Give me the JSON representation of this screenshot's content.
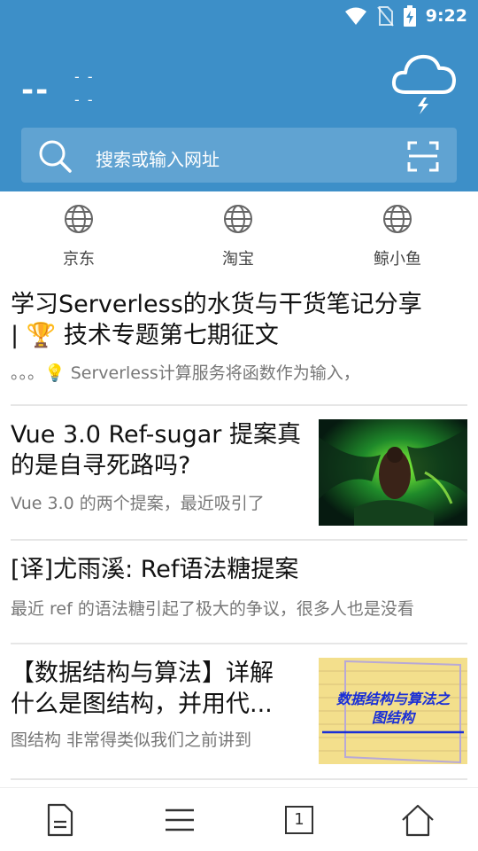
{
  "status_bar": {
    "time": "9:22",
    "icons": [
      "wifi-icon",
      "no-sim-icon",
      "battery-charging-icon"
    ]
  },
  "weather": {
    "temperature": "--",
    "range_high": "- -",
    "range_low": "- -",
    "icon": "cloud-thunder-icon"
  },
  "search": {
    "placeholder": "搜索或输入网址",
    "icon": "search-icon",
    "scan_icon": "scan-icon"
  },
  "shortcuts": [
    {
      "label": "京东",
      "icon": "globe-icon"
    },
    {
      "label": "淘宝",
      "icon": "globe-icon"
    },
    {
      "label": "鲸小鱼",
      "icon": "globe-icon"
    }
  ],
  "articles": [
    {
      "title_line1": " 学习Serverless的水货与干货笔记分享",
      "title_line2": "| 🏆 技术专题第七期征文",
      "summary": " 。。。💡 Serverless计算服务将函数作为输入，",
      "has_image": false
    },
    {
      "title_line1": "Vue 3.0 Ref-sugar 提案真",
      "title_line2": "的是自寻死路吗?",
      "summary": " Vue 3.0 的两个提案，最近吸引了",
      "has_image": true,
      "image_desc": "green-dragon-artwork"
    },
    {
      "title_line1": "[译]尤雨溪: Ref语法糖提案",
      "title_line2": "",
      "summary": " 最近 ref 的语法糖引起了极大的争议，很多人也是没看",
      "has_image": false
    },
    {
      "title_line1": "【数据结构与算法】详解",
      "title_line2": "什么是图结构，并用代...",
      "summary": " 图结构 非常得类似我们之前讲到",
      "has_image": true,
      "image_text_line1": "数据结构与算法之",
      "image_text_line2": "图结构"
    }
  ],
  "bottom_nav": {
    "tab_count": "1",
    "items": [
      "document-icon",
      "menu-icon",
      "tabs-icon",
      "home-icon"
    ]
  },
  "colors": {
    "header_bg": "#3d8fc8",
    "text_primary": "#111111",
    "text_secondary": "#777777",
    "divider": "#e6e6e6",
    "image_title_blue": "#1a2fd6"
  }
}
